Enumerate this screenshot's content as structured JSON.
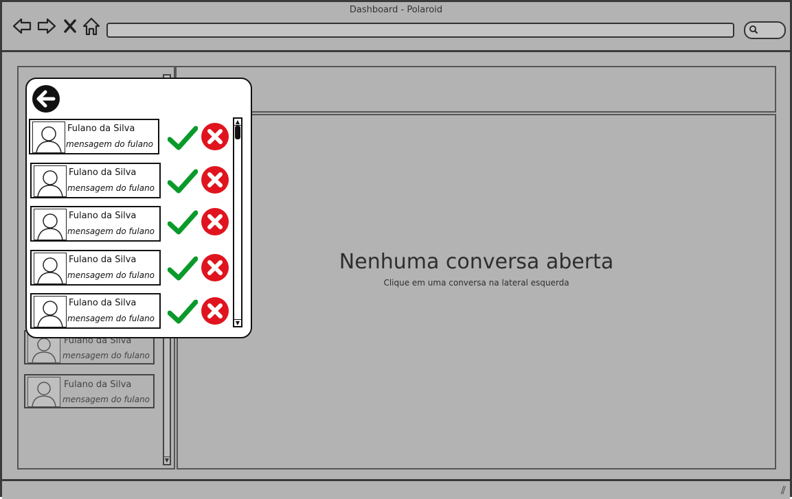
{
  "window": {
    "title": "Dashboard - Polaroid"
  },
  "browser": {
    "nav_icons": [
      "back-arrow-icon",
      "forward-arrow-icon",
      "close-icon",
      "home-icon"
    ],
    "search_icon": "search-icon"
  },
  "sidebar": {
    "background_items": [
      {
        "name": "Fulano da Silva",
        "message": "mensagem do fulano"
      },
      {
        "name": "Fulano da Silva",
        "message": "mensagem do fulano"
      }
    ]
  },
  "main": {
    "empty_title": "Nenhuma conversa aberta",
    "empty_subtitle": "Clique em uma conversa na lateral esquerda"
  },
  "requests_popover": {
    "back_icon": "back-circle-icon",
    "requests": [
      {
        "name": "Fulano da Silva",
        "message": "mensagem do fulano"
      },
      {
        "name": "Fulano da Silva",
        "message": "mensagem do fulano"
      },
      {
        "name": "Fulano da Silva",
        "message": "mensagem do fulano"
      },
      {
        "name": "Fulano da Silva",
        "message": "mensagem do fulano"
      },
      {
        "name": "Fulano da Silva",
        "message": "mensagem do fulano"
      }
    ],
    "accept_color": "#0a9a2a",
    "reject_color": "#e0141e"
  }
}
